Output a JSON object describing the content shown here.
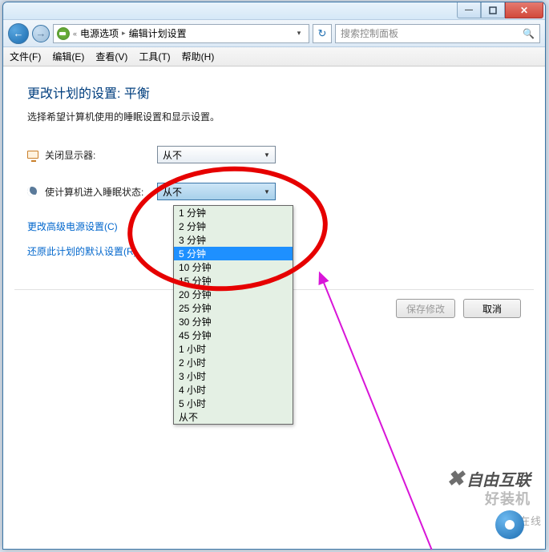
{
  "titlebar": {
    "min": "—",
    "max": "❐",
    "close": "✕"
  },
  "nav": {
    "back": "←",
    "fwd": "→",
    "chev": "▸",
    "drop": "▾",
    "refresh": "↻",
    "crumb1": "电源选项",
    "crumb2": "编辑计划设置",
    "search_placeholder": "搜索控制面板"
  },
  "menu": {
    "file": "文件(F)",
    "edit": "编辑(E)",
    "view": "查看(V)",
    "tools": "工具(T)",
    "help": "帮助(H)"
  },
  "heading": "更改计划的设置: 平衡",
  "subtext": "选择希望计算机使用的睡眠设置和显示设置。",
  "row1": {
    "label": "关闭显示器:",
    "value": "从不"
  },
  "row2": {
    "label": "使计算机进入睡眠状态:",
    "value": "从不"
  },
  "links": {
    "adv": "更改高级电源设置(C)",
    "restore": "还原此计划的默认设置(R)"
  },
  "buttons": {
    "save": "保存修改",
    "cancel": "取消"
  },
  "dropdown_options": [
    "1 分钟",
    "2 分钟",
    "3 分钟",
    "5 分钟",
    "10 分钟",
    "15 分钟",
    "20 分钟",
    "25 分钟",
    "30 分钟",
    "45 分钟",
    "1 小时",
    "2 小时",
    "3 小时",
    "4 小时",
    "5 小时",
    "从不"
  ],
  "dropdown_selected_index": 3,
  "watermark1": "自由互联",
  "watermark1b": "好装机",
  "watermark2b": "在线"
}
